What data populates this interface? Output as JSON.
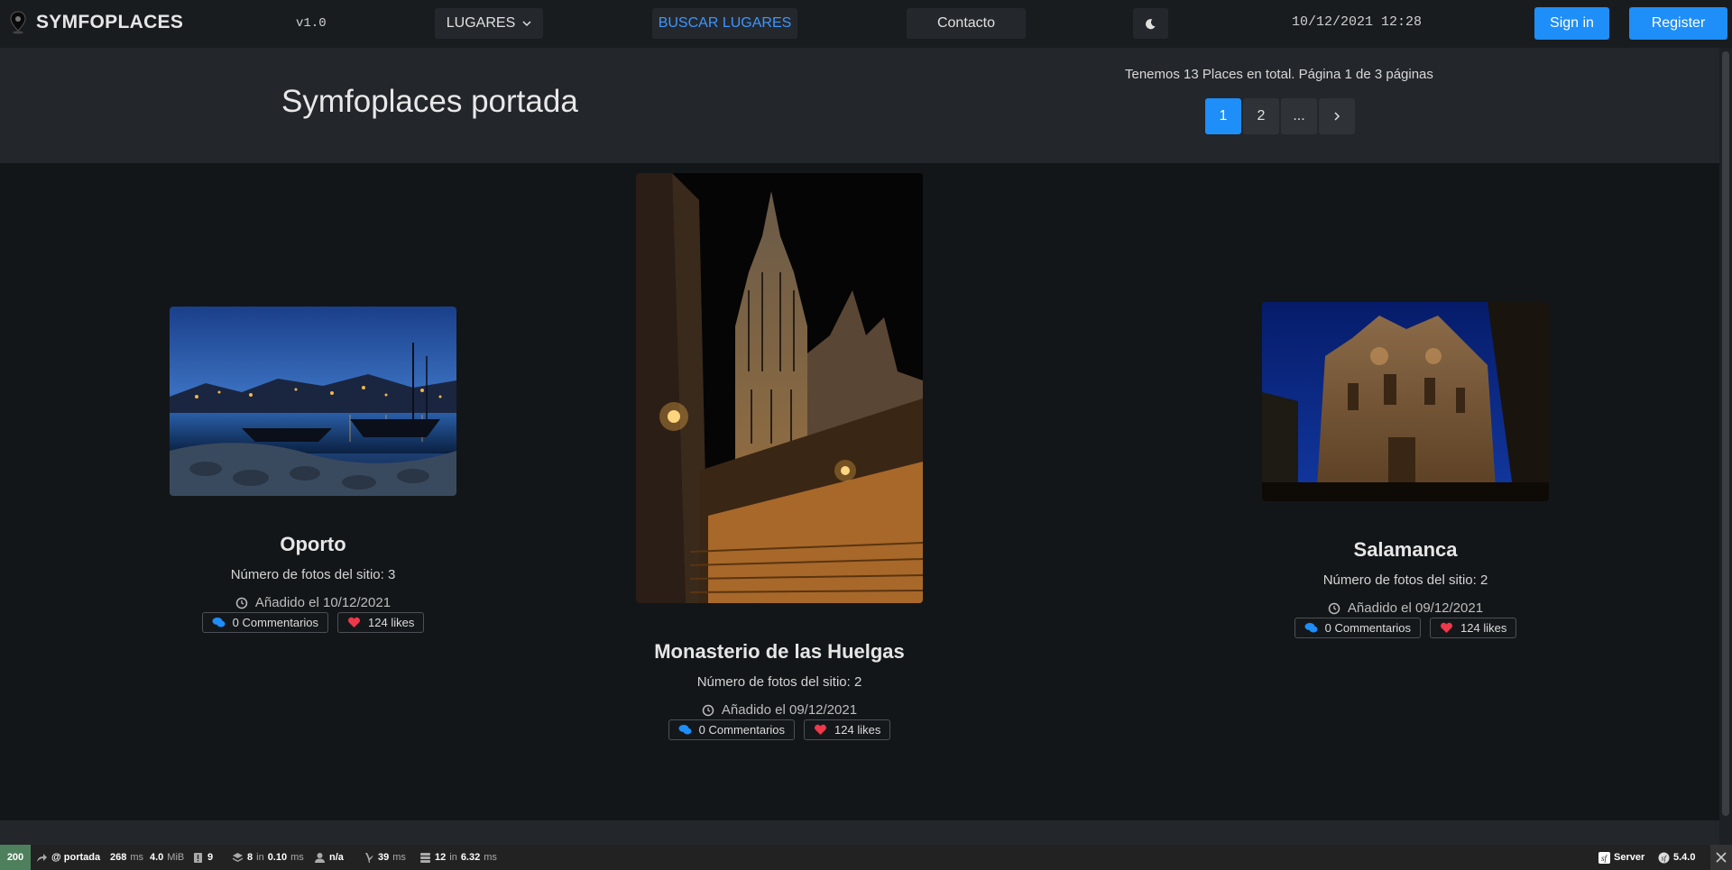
{
  "nav": {
    "brand": "SYMFOPLACES",
    "version": "v1.0",
    "lugares": "LUGARES",
    "buscar": "BUSCAR LUGARES",
    "contacto": "Contacto",
    "datetime": "10/12/2021 12:28",
    "sign_in": "Sign in",
    "register": "Register"
  },
  "header": {
    "title": "Symfoplaces portada",
    "summary": "Tenemos 13 Places en total. Página 1 de 3 páginas",
    "pages": [
      "1",
      "2",
      "..."
    ]
  },
  "cards": [
    {
      "title": "Oporto",
      "photos": "Número de fotos del sitio: 3",
      "date": "Añadido el 10/12/2021",
      "comments": "0 Commentarios",
      "likes": "124 likes"
    },
    {
      "title": "Monasterio de las Huelgas",
      "photos": "Número de fotos del sitio: 2",
      "date": "Añadido el 09/12/2021",
      "comments": "0 Commentarios",
      "likes": "124 likes"
    },
    {
      "title": "Salamanca",
      "photos": "Número de fotos del sitio: 2",
      "date": "Añadido el 09/12/2021",
      "comments": "0 Commentarios",
      "likes": "124 likes"
    }
  ],
  "toolbar": {
    "status": "200",
    "route": "@ portada",
    "time": "268",
    "time_unit": "ms",
    "memory": "4.0",
    "memory_unit": "MiB",
    "logs": "9",
    "cache": "8",
    "cache_mid": "in",
    "cache_time": "0.10",
    "cache_unit": "ms",
    "user": "n/a",
    "twig": "39",
    "twig_unit": "ms",
    "db": "12",
    "db_mid": "in",
    "db_time": "6.32",
    "db_unit": "ms",
    "server": "Server",
    "symfony_version": "5.4.0"
  },
  "colors": {
    "accent": "#1e8ef9",
    "background": "#131618",
    "header": "#23262b",
    "status_ok": "#4f805d"
  }
}
